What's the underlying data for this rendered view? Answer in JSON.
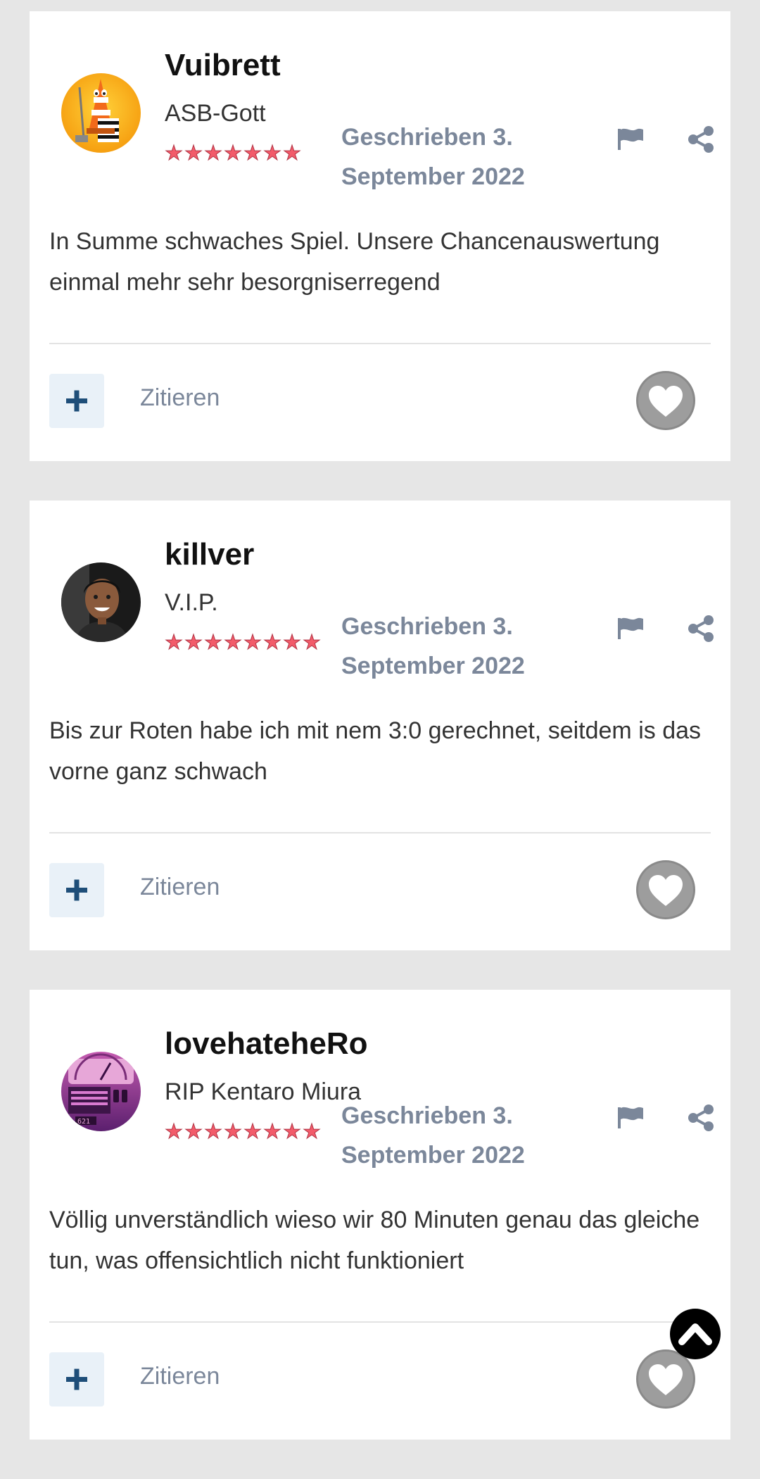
{
  "posts": [
    {
      "author": "Vuibrett",
      "rank": "ASB-Gott",
      "stars": "★★★★★★★",
      "avatar_icon": "traffic-cone-mascot-avatar",
      "date": "Geschrieben 3. September 2022",
      "content": "In Summe schwaches Spiel. Unsere Chancenauswertung einmal mehr sehr besorgniserregend",
      "quote_label": "Zitieren"
    },
    {
      "author": "killver",
      "rank": "V.I.P.",
      "stars": "★★★★★★★★",
      "avatar_icon": "person-photo-avatar",
      "date": "Geschrieben 3. September 2022",
      "content": "Bis zur Roten habe ich mit nem 3:0 gerechnet, seitdem is das vorne ganz schwach",
      "quote_label": "Zitieren"
    },
    {
      "author": "lovehateheRo",
      "rank": "RIP Kentaro Miura",
      "stars": "★★★★★★★★",
      "avatar_icon": "retro-radio-avatar",
      "date": "Geschrieben 3. September 2022",
      "content": "Völlig unverständlich wieso wir 80 Minuten genau das gleiche tun, was offensichtlich nicht funktioniert",
      "quote_label": "Zitieren"
    }
  ],
  "icons": {
    "flag": "flag-icon",
    "share": "share-icon",
    "plus": "plus-icon",
    "like": "heart-icon",
    "scroll_top": "chevron-up-icon"
  },
  "colors": {
    "stars": "#f25b6a",
    "meta_text": "#7b879a",
    "plus_bg": "#e9f1f8",
    "plus_icon": "#1e4e79",
    "like_bg": "#9d9d9d"
  }
}
